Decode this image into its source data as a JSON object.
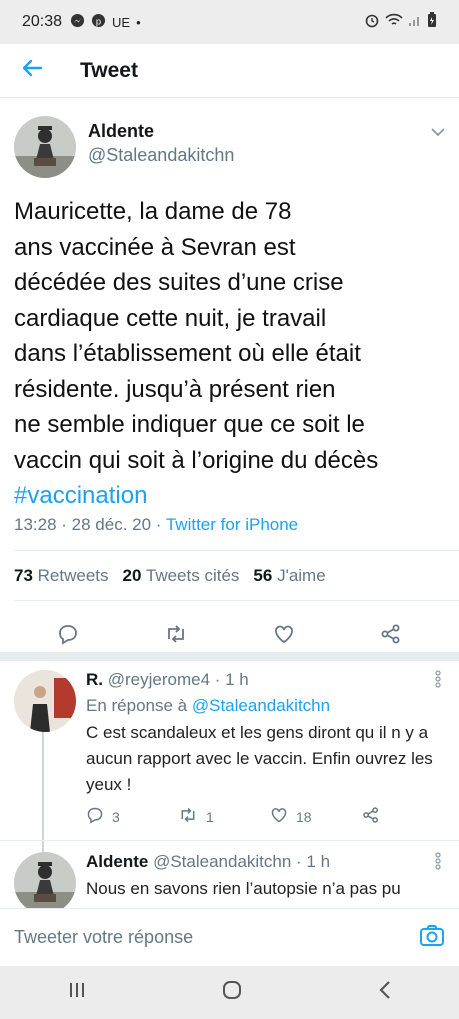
{
  "status_bar": {
    "time": "20:38",
    "notif_label": "UE",
    "dot": "•"
  },
  "header": {
    "title": "Tweet"
  },
  "tweet": {
    "author": "Aldente",
    "handle": "@Staleandakitchn",
    "lines": [
      "Mauricette, la dame de 78",
      "ans vaccinée à Sevran est",
      "décédée des suites d’une crise",
      "cardiaque cette nuit, je travail",
      "dans l’établissement où elle était",
      "résidente.  jusqu’à présent rien",
      "ne semble indiquer que ce soit le",
      "vaccin qui soit  à l’origine du décès"
    ],
    "hashtag": "#vaccination",
    "time": "13:28 · 28 déc. 20 · ",
    "source": "Twitter for iPhone",
    "retweets_count": "73",
    "retweets_label": "Retweets",
    "quotes_count": "20",
    "quotes_label": "Tweets cités",
    "likes_count": "56",
    "likes_label": "J'aime"
  },
  "replies": [
    {
      "author": "R.",
      "handle_time": "@reyjerome4 · 1 h",
      "in_reply_prefix": "En réponse à ",
      "in_reply_handle": "@Staleandakitchn",
      "body": "C est scandaleux et les gens diront qu il n y a aucun rapport avec le vaccin. Enfin ouvrez les yeux !",
      "reply_count": "3",
      "retweet_count": "1",
      "like_count": "18"
    },
    {
      "author": "Aldente",
      "handle_time": "@Staleandakitchn · 1 h",
      "body": "Nous en savons rien l’autopsie n’a pas pu avoir lieu, faute de place à cause du"
    }
  ],
  "compose": {
    "placeholder": "Tweeter votre réponse"
  },
  "colors": {
    "accent": "#1da1f2",
    "text": "#14171a",
    "muted": "#657786"
  },
  "icons": [
    "back-arrow-icon",
    "chevron-down-icon",
    "reply-icon",
    "retweet-icon",
    "like-icon",
    "share-icon",
    "more-vertical-icon",
    "camera-icon",
    "recents-icon",
    "home-icon",
    "back-icon"
  ]
}
